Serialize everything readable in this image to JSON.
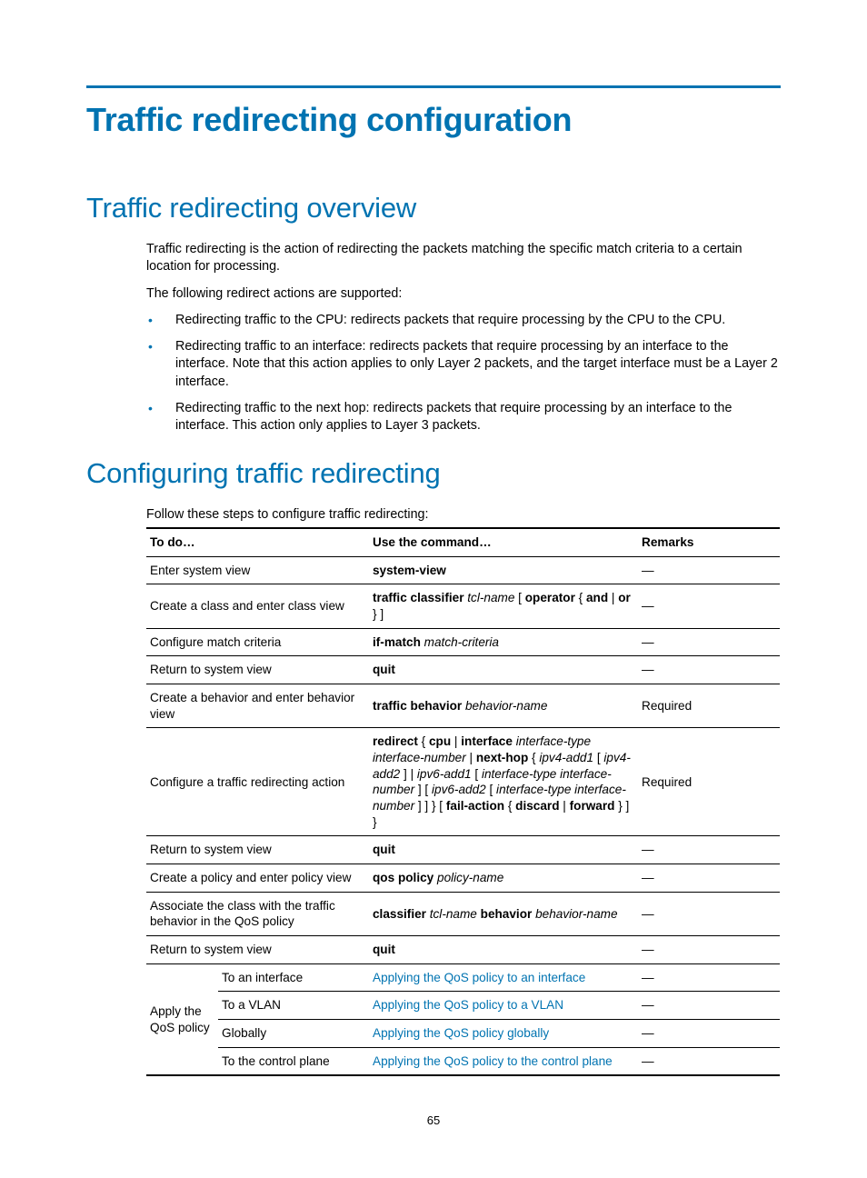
{
  "page_number": "65",
  "title": "Traffic redirecting configuration",
  "section_overview": {
    "heading": "Traffic redirecting overview",
    "p1": "Traffic redirecting is the action of redirecting the packets matching the specific match criteria to a certain location for processing.",
    "p2": "The following redirect actions are supported:",
    "bullet1": "Redirecting traffic to the CPU: redirects packets that require processing by the CPU to the CPU.",
    "bullet2": "Redirecting traffic to an interface: redirects packets that require processing by an interface to the interface. Note that this action applies to only Layer 2 packets, and the target interface must be a Layer 2 interface.",
    "bullet3": "Redirecting traffic to the next hop: redirects packets that require processing by an interface to the interface. This action only applies to Layer 3 packets."
  },
  "section_config": {
    "heading": "Configuring traffic redirecting",
    "intro": "Follow these steps to configure traffic redirecting:",
    "headers": {
      "todo": "To do…",
      "cmd": "Use the command…",
      "remarks": "Remarks"
    },
    "rows": {
      "r1": {
        "todo": "Enter system view",
        "cmd": "system-view",
        "remark": "—"
      },
      "r2": {
        "todo": "Create a class and enter class view",
        "cmd_pre": "traffic classifier ",
        "cmd_ital1": "tcl-name",
        "cmd_mid1": " [ ",
        "cmd_bold1": "operator",
        "cmd_mid2": " { ",
        "cmd_bold2": "and",
        "cmd_mid3": " | ",
        "cmd_bold3": "or",
        "cmd_end": " } ]",
        "remark": "—"
      },
      "r3": {
        "todo": "Configure match criteria",
        "cmd_pre": "if-match ",
        "cmd_ital": "match-criteria",
        "remark": "—"
      },
      "r4": {
        "todo": "Return to system view",
        "cmd": "quit",
        "remark": "—"
      },
      "r5": {
        "todo": "Create a behavior and enter behavior view",
        "cmd_pre": "traffic behavior ",
        "cmd_ital": "behavior-name",
        "remark": "Required"
      },
      "r6": {
        "todo": "Configure a traffic redirecting action",
        "cmd_b1": "redirect",
        "cmd_t1": " { ",
        "cmd_b2": "cpu",
        "cmd_t2": " | ",
        "cmd_b3": "interface",
        "cmd_t3": " ",
        "cmd_i1": "interface-type interface-number",
        "cmd_t4": " | ",
        "cmd_b4": "next-hop",
        "cmd_t5": " { ",
        "cmd_i2": "ipv4-add1",
        "cmd_t6": " [ ",
        "cmd_i3": "ipv4-add2",
        "cmd_t7": " ] | ",
        "cmd_i4": "ipv6-add1",
        "cmd_t8": " [ ",
        "cmd_i5": "interface-type interface-number",
        "cmd_t9": " ] [ ",
        "cmd_i6": "ipv6-add2",
        "cmd_t10": " [ ",
        "cmd_i7": "interface-type interface-number",
        "cmd_t11": " ] ] } [ ",
        "cmd_b5": "fail-action",
        "cmd_t12": " { ",
        "cmd_b6": "discard",
        "cmd_t13": " | ",
        "cmd_b7": "forward",
        "cmd_t14": " } ] }",
        "remark": "Required"
      },
      "r7": {
        "todo": "Return to system view",
        "cmd": "quit",
        "remark": "—"
      },
      "r8": {
        "todo": "Create a policy and enter policy view",
        "cmd_pre": "qos policy ",
        "cmd_ital": "policy-name",
        "remark": "—"
      },
      "r9": {
        "todo": "Associate the class with the traffic behavior in the QoS policy",
        "cmd_b1": "classifier",
        "cmd_t1": " ",
        "cmd_i1": "tcl-name",
        "cmd_t2": " ",
        "cmd_b2": "behavior",
        "cmd_t3": " ",
        "cmd_i2": "behavior-name",
        "remark": "—"
      },
      "r10": {
        "todo": "Return to system view",
        "cmd": "quit",
        "remark": "—"
      },
      "apply_label": "Apply the QoS policy",
      "r11": {
        "sub": "To an interface",
        "link": "Applying the QoS policy to an interface",
        "remark": "—"
      },
      "r12": {
        "sub": "To a VLAN",
        "link": "Applying the QoS policy to a VLAN",
        "remark": "—"
      },
      "r13": {
        "sub": "Globally",
        "link": "Applying the QoS policy globally",
        "remark": "—"
      },
      "r14": {
        "sub": "To the control plane",
        "link": "Applying the QoS policy to the control plane",
        "remark": "—"
      }
    }
  }
}
